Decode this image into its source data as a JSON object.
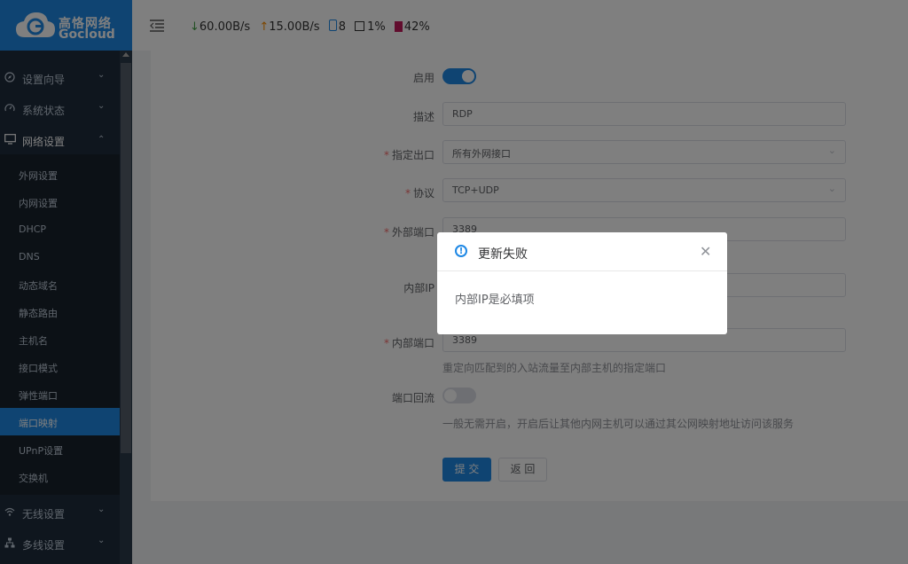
{
  "brand": {
    "name_cn": "高恪网络",
    "name_en": "Gocloud"
  },
  "header": {
    "download": "60.00B/s",
    "upload": "15.00B/s",
    "devices": "8",
    "cpu": "1%",
    "memory": "42%"
  },
  "sidebar": {
    "top_items": [
      {
        "label": "设置向导",
        "icon": "compass-icon"
      },
      {
        "label": "系统状态",
        "icon": "gauge-icon"
      },
      {
        "label": "网络设置",
        "icon": "monitor-icon"
      }
    ],
    "sub_items": [
      "外网设置",
      "内网设置",
      "DHCP",
      "DNS",
      "动态域名",
      "静态路由",
      "主机名",
      "接口模式",
      "弹性端口",
      "端口映射",
      "UPnP设置",
      "交换机"
    ],
    "active_sub": "端口映射",
    "bottom_items": [
      {
        "label": "无线设置",
        "icon": "wifi-icon"
      },
      {
        "label": "多线设置",
        "icon": "network-icon"
      }
    ]
  },
  "form": {
    "enable_label": "启用",
    "enable_on": true,
    "desc_label": "描述",
    "desc_value": "RDP",
    "outlet_label": "指定出口",
    "outlet_value": "所有外网接口",
    "protocol_label": "协议",
    "protocol_value": "TCP+UDP",
    "ext_port_label": "外部端口",
    "ext_port_value": "3389",
    "internal_ip_label": "内部IP",
    "int_port_label": "内部端口",
    "int_port_value": "3389",
    "int_port_hint": "重定向匹配到的入站流量至内部主机的指定端口",
    "loopback_label": "端口回流",
    "loopback_on": false,
    "loopback_hint": "一般无需开启，开启后让其他内网主机可以通过其公网映射地址访问该服务",
    "submit_label": "提 交",
    "back_label": "返 回"
  },
  "dialog": {
    "title": "更新失败",
    "message": "内部IP是必填项"
  },
  "colors": {
    "accent": "#1e88e5",
    "sidebar": "#1f2d3d",
    "required": "#f56c6c"
  }
}
